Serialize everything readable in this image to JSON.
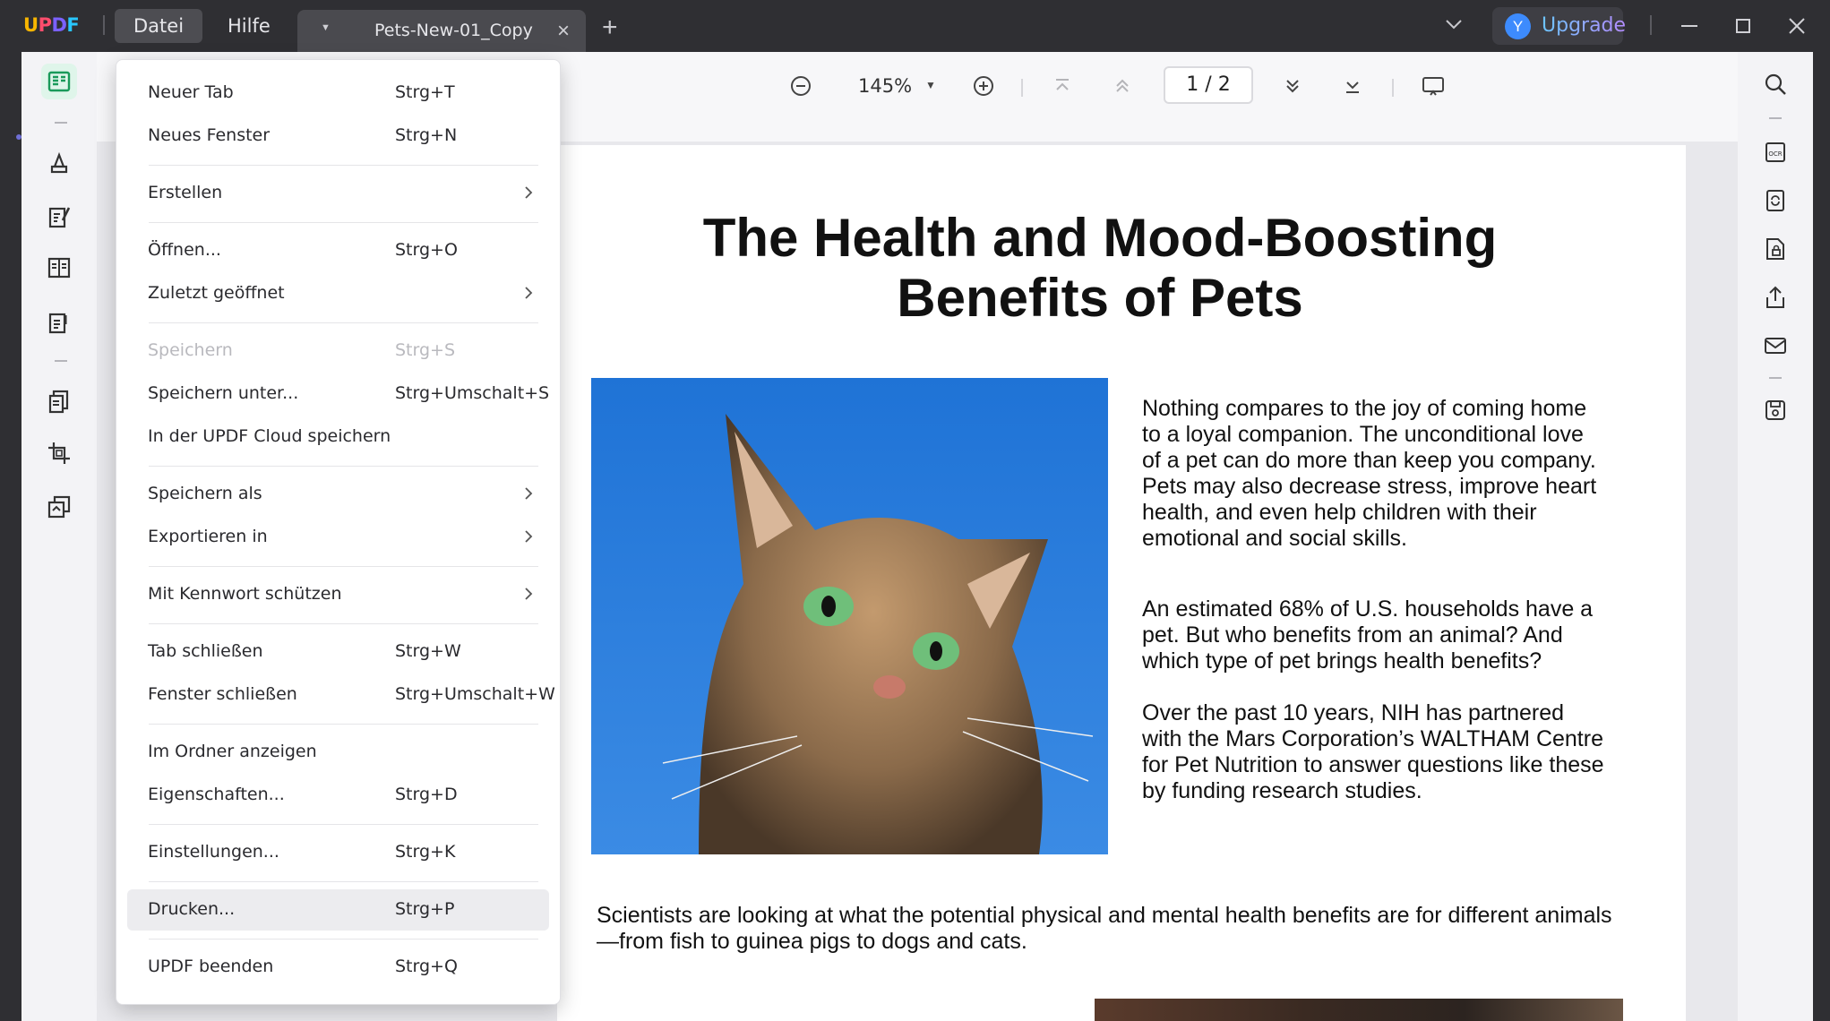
{
  "app": {
    "logo": [
      "U",
      "P",
      "D",
      "F"
    ],
    "logo_colors": [
      "#f7b500",
      "#ff4d6d",
      "#7b61ff",
      "#28c7ff"
    ],
    "menu": [
      "Datei",
      "Hilfe"
    ],
    "tab_title": "Pets-New-01_Copy",
    "upgrade_avatar": "Y",
    "upgrade_label": "Upgrade"
  },
  "toolbar": {
    "zoom": "145%",
    "page_current": "1",
    "page_sep": "/",
    "page_total": "2"
  },
  "file_menu": {
    "items": [
      {
        "label": "Neuer Tab",
        "shortcut": "Strg+T"
      },
      {
        "label": "Neues Fenster",
        "shortcut": "Strg+N"
      },
      {
        "label": "Erstellen",
        "shortcut": ""
      },
      {
        "label": "Öffnen...",
        "shortcut": "Strg+O"
      },
      {
        "label": "Zuletzt geöffnet",
        "shortcut": ""
      },
      {
        "label": "Speichern",
        "shortcut": "Strg+S"
      },
      {
        "label": "Speichern unter...",
        "shortcut": "Strg+Umschalt+S"
      },
      {
        "label": "In der UPDF Cloud speichern",
        "shortcut": ""
      },
      {
        "label": "Speichern als",
        "shortcut": ""
      },
      {
        "label": "Exportieren in",
        "shortcut": ""
      },
      {
        "label": "Mit Kennwort schützen",
        "shortcut": ""
      },
      {
        "label": "Tab schließen",
        "shortcut": "Strg+W"
      },
      {
        "label": "Fenster schließen",
        "shortcut": "Strg+Umschalt+W"
      },
      {
        "label": "Im Ordner anzeigen",
        "shortcut": ""
      },
      {
        "label": "Eigenschaften...",
        "shortcut": "Strg+D"
      },
      {
        "label": "Einstellungen...",
        "shortcut": "Strg+K"
      },
      {
        "label": "Drucken...",
        "shortcut": "Strg+P"
      },
      {
        "label": "UPDF beenden",
        "shortcut": "Strg+Q"
      }
    ]
  },
  "document": {
    "title_line1": "The Health and Mood-Boosting",
    "title_line2": "Benefits of Pets",
    "para1": "Nothing compares to the joy of coming home to a loyal companion. The unconditional love of a pet can do more than keep you company. Pets may also decrease stress, improve heart health,  and  even  help children  with  their emotional and social skills.",
    "para2": "An estimated 68% of U.S. households have a pet. But who benefits from an animal? And which type of pet brings health benefits?",
    "para3": "Over  the  past  10  years,  NIH  has partnered with the Mars Corporation’s WALTHAM Centre for  Pet  Nutrition  to answer  questions  like these by funding research studies.",
    "para4": "Scientists are looking at what the potential physical and mental health benefits are for different animals—from fish to guinea pigs to dogs and cats."
  }
}
